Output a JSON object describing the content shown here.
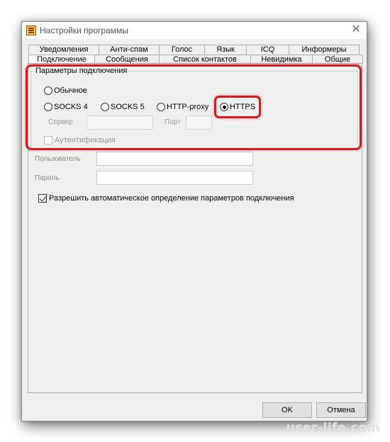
{
  "window": {
    "title": "Настройки программы",
    "close_glyph": "✕"
  },
  "tabs_row1": [
    "Уведомления",
    "Анти-спам",
    "Голос",
    "Язык",
    "ICQ",
    "Информеры"
  ],
  "tabs_row2": [
    "Подключение",
    "Сообщения",
    "Список контактов",
    "Невидимка",
    "Общие"
  ],
  "group": {
    "legend": "Параметры подключения",
    "radios": {
      "normal": "Обычное",
      "socks4": "SOCKS 4",
      "socks5": "SOCKS 5",
      "http": "HTTP-proxy",
      "https": "HTTPS"
    },
    "selected": "HTTPS",
    "server_label": "Сервер",
    "port_label": "Порт",
    "auth_label": "Аутентификация"
  },
  "user_label": "Пользователь",
  "password_label": "Пароль",
  "auto_detect_label": "Разрешить автоматическое определение параметров подключения",
  "auto_detect_checked": true,
  "buttons": {
    "ok": "OK",
    "cancel": "Отмена"
  },
  "watermark": "user-life.com",
  "colors": {
    "highlight": "#d9191f",
    "dialog_bg": "#f0f0f0"
  }
}
